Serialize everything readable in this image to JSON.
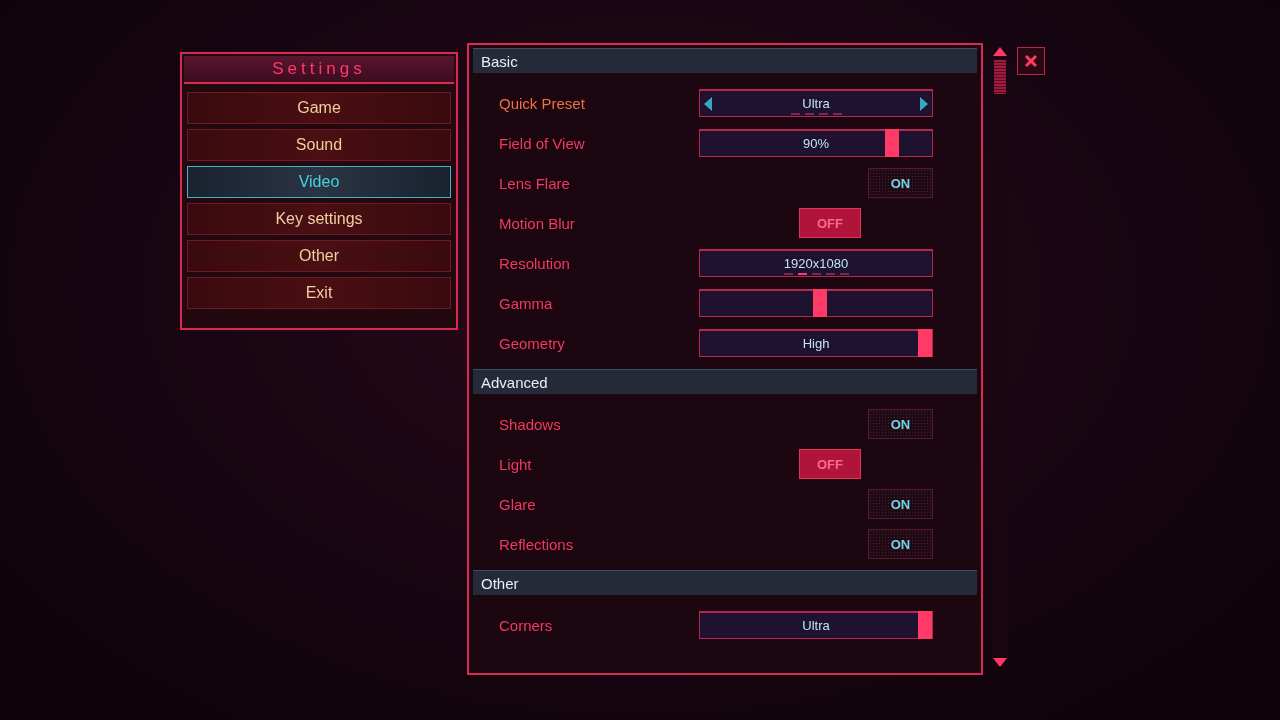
{
  "menu": {
    "title": "Settings",
    "items": [
      {
        "label": "Game",
        "selected": false
      },
      {
        "label": "Sound",
        "selected": false
      },
      {
        "label": "Video",
        "selected": true
      },
      {
        "label": "Key settings",
        "selected": false
      },
      {
        "label": "Other",
        "selected": false
      },
      {
        "label": "Exit",
        "selected": false
      }
    ]
  },
  "sections": [
    {
      "title": "Basic",
      "rows": [
        {
          "kind": "selector",
          "label": "Quick Preset",
          "focused": true,
          "value": "Ultra",
          "dashes": [
            {
              "selected": false
            },
            {
              "selected": false
            },
            {
              "selected": false
            },
            {
              "selected": false
            }
          ]
        },
        {
          "kind": "slider",
          "label": "Field of View",
          "focused": false,
          "value": "90%",
          "level": 0.85
        },
        {
          "kind": "toggle",
          "label": "Lens Flare",
          "focused": false,
          "on": true,
          "value": "ON"
        },
        {
          "kind": "toggle",
          "label": "Motion Blur",
          "focused": false,
          "on": false,
          "value": "OFF"
        },
        {
          "kind": "list",
          "label": "Resolution",
          "focused": false,
          "value": "1920x1080",
          "dashes": [
            {
              "selected": false
            },
            {
              "selected": true
            },
            {
              "selected": false
            },
            {
              "selected": false
            },
            {
              "selected": false
            }
          ]
        },
        {
          "kind": "slider",
          "label": "Gamma",
          "focused": false,
          "level": 0.52
        },
        {
          "kind": "slider",
          "label": "Geometry",
          "focused": false,
          "value": "High",
          "level": 1
        }
      ]
    },
    {
      "title": "Advanced",
      "rows": [
        {
          "kind": "toggle",
          "label": "Shadows",
          "focused": false,
          "on": true,
          "value": "ON"
        },
        {
          "kind": "toggle",
          "label": "Light",
          "focused": false,
          "on": false,
          "value": "OFF"
        },
        {
          "kind": "toggle",
          "label": "Glare",
          "focused": false,
          "on": true,
          "value": "ON"
        },
        {
          "kind": "toggle",
          "label": "Reflections",
          "focused": false,
          "on": true,
          "value": "ON"
        }
      ]
    },
    {
      "title": "Other",
      "rows": [
        {
          "kind": "slider",
          "label": "Corners",
          "focused": false,
          "value": "Ultra",
          "level": 1
        }
      ]
    }
  ]
}
